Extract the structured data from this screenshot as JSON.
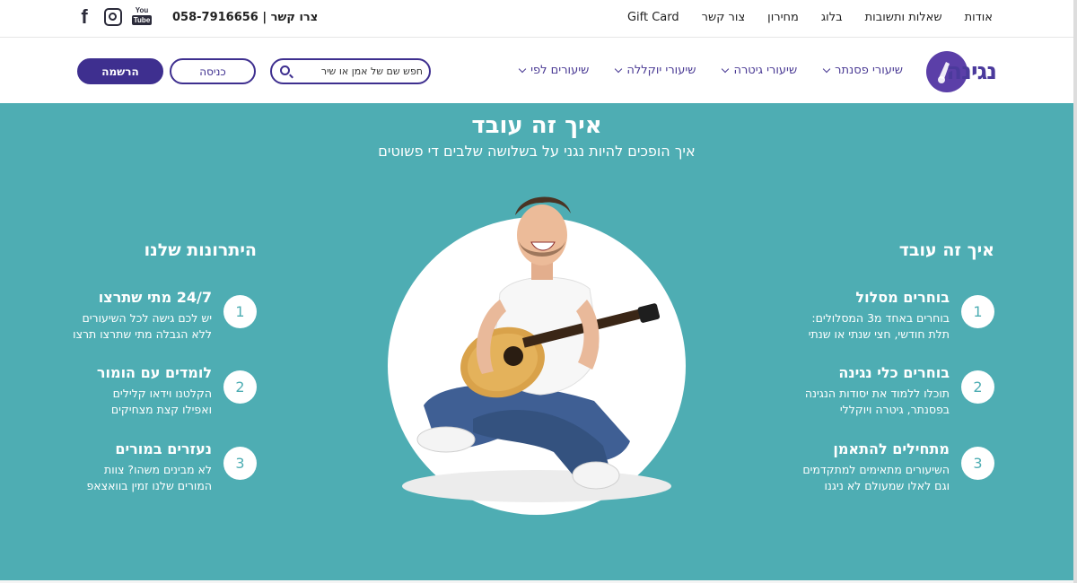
{
  "topbar": {
    "nav": [
      "אודות",
      "שאלות ותשובות",
      "בלוג",
      "מחירון",
      "צור קשר",
      "Gift Card"
    ],
    "contact": "צרו קשר | 058-7916656",
    "social": [
      "facebook-icon",
      "instagram-icon",
      "youtube-icon"
    ],
    "youtube_you": "You",
    "youtube_tube": "Tube"
  },
  "header": {
    "logo_text": "נגינה",
    "nav": [
      {
        "label": "שיעורים לפי"
      },
      {
        "label": "שיעורי יוקללה"
      },
      {
        "label": "שיעורי גיטרה"
      },
      {
        "label": "שיעורי פסנתר"
      }
    ],
    "search_placeholder": "חפש שם של אמן או שיר",
    "login": "כניסה",
    "signup": "הרשמה"
  },
  "section": {
    "title": "איך זה עובד",
    "subtitle": "איך הופכים להיות נגני על בשלושה שלבים די פשוטים",
    "right_title": "איך זה עובד",
    "left_title": "היתרונות שלנו",
    "right_steps": [
      {
        "num": "1",
        "title": "בוחרים מסלול",
        "line1": "בוחרים באחד מ3 המסלולים:",
        "line2": "תלת חודשי, חצי שנתי או שנתי"
      },
      {
        "num": "2",
        "title": "בוחרים כלי נגינה",
        "line1": "תוכלו ללמוד את יסודות הנגינה",
        "line2": "בפסנתר, גיטרה ויוקללי"
      },
      {
        "num": "3",
        "title": "מתחילים להתאמן",
        "line1": "השיעורים מתאימים למתקדמים",
        "line2": "וגם לאלו שמעולם לא ניגנו"
      }
    ],
    "left_steps": [
      {
        "num": "1",
        "title": "24/7 מתי שתרצו",
        "line1": "יש לכם גישה לכל השיעורים",
        "line2": "ללא הגבלה מתי שתרצו תרצו"
      },
      {
        "num": "2",
        "title": "לומדים עם הומור",
        "line1": "הקלטנו וידאו קלילים",
        "line2": "ואפילו קצת מצחיקים"
      },
      {
        "num": "3",
        "title": "נעזרים במורים",
        "line1": "לא מבינים משהו? צוות",
        "line2": "המורים שלנו זמין בוואצאפ"
      }
    ]
  },
  "colors": {
    "teal": "#4eadb3",
    "brand_purple": "#3e2f8f"
  }
}
